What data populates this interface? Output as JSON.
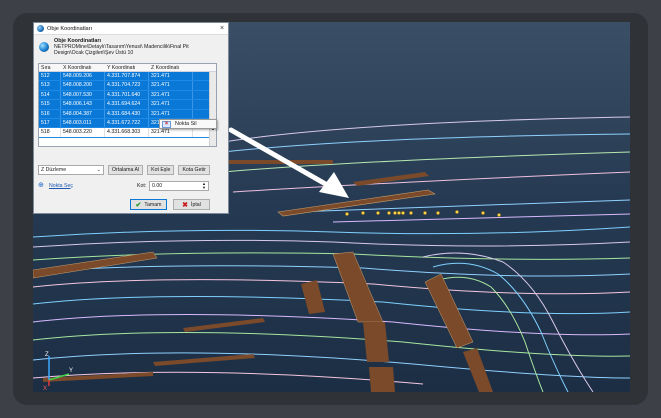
{
  "dialog": {
    "window_title": "Obje Koordinatları",
    "close_glyph": "×",
    "header_title": "Obje Koordinatları",
    "header_path_1": "NETPROMine\\Detaylı\\Tasarım\\Yenusi\\ Madencilik\\Final Pit",
    "header_path_2": "Design\\Ocak Çizgileri\\Şev Üstü 10",
    "columns": [
      "Sıra",
      "X Koordinatı",
      "Y Koordinatı",
      "Z Koordinatı"
    ],
    "rows": [
      [
        "512",
        "548.009.206",
        "4.331.707.874",
        "321.471"
      ],
      [
        "513",
        "548.008.200",
        "4.331.704.723",
        "321.471"
      ],
      [
        "514",
        "548.007.530",
        "4.331.701.640",
        "321.471"
      ],
      [
        "515",
        "548.006.143",
        "4.331.694.624",
        "321.471"
      ],
      [
        "516",
        "548.004.387",
        "4.331.684.430",
        "321.471"
      ],
      [
        "517",
        "548.003.011",
        "4.331.672.722",
        "321.471"
      ],
      [
        "518",
        "548.003.220",
        "4.331.668.303",
        "321.471"
      ]
    ],
    "context_menu": {
      "label": "Nokta Sil"
    },
    "select_value": "Z Düzleme",
    "btn_average": "Ortalama Al",
    "btn_equal": "Kot Eşle",
    "btn_get_elev": "Kota Getir",
    "link_point_select": "Nokta Seç",
    "kot_label": "Kot:",
    "kot_value": "0.00",
    "btn_ok": "Tamam",
    "btn_cancel": "İptal"
  },
  "axes": {
    "z": "Z",
    "y": "Y",
    "x": "X"
  },
  "colors": {
    "selection": "#0a78d7",
    "annotation_arrow": "#ffffff",
    "bench_fill": "#7a4a2a",
    "contour_lines": [
      "#5bd3ff",
      "#a8e6a0",
      "#d9b8ff",
      "#f5c6e0"
    ]
  },
  "icons": [
    "app-icon",
    "globe-icon",
    "delete-icon",
    "pin-icon",
    "check-icon",
    "cancel-icon"
  ]
}
